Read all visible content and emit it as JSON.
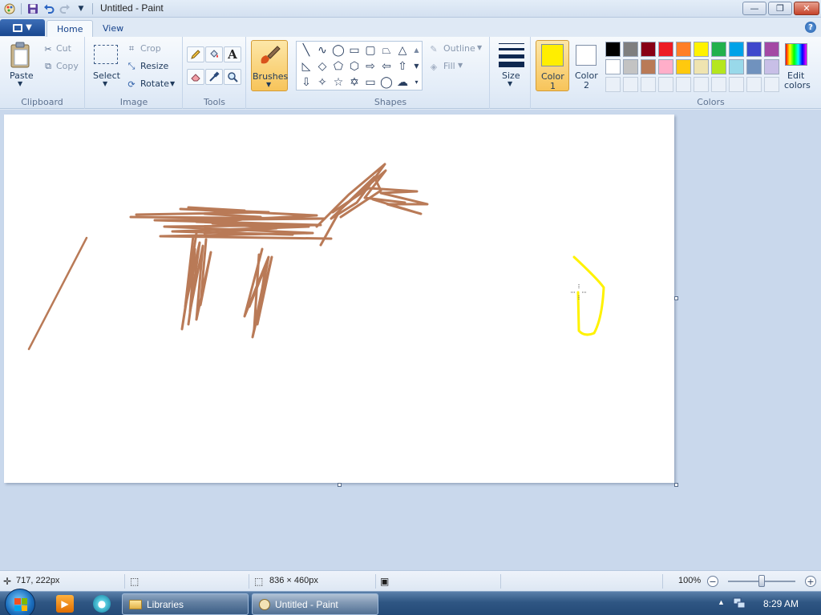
{
  "window": {
    "title": "Untitled - Paint",
    "minimize_label": "—",
    "restore_label": "❐",
    "close_label": "✕"
  },
  "tabs": [
    {
      "label": "Home"
    },
    {
      "label": "View"
    }
  ],
  "clipboard": {
    "paste_label": "Paste",
    "cut_label": "Cut",
    "copy_label": "Copy",
    "group_label": "Clipboard"
  },
  "image": {
    "select_label": "Select",
    "crop_label": "Crop",
    "resize_label": "Resize",
    "rotate_label": "Rotate",
    "group_label": "Image"
  },
  "tools": {
    "group_label": "Tools"
  },
  "brushes": {
    "label": "Brushes"
  },
  "shapes": {
    "outline_label": "Outline",
    "fill_label": "Fill",
    "group_label": "Shapes"
  },
  "size": {
    "label": "Size"
  },
  "colors": {
    "color1_label_line1": "Color",
    "color1_label_line2": "1",
    "color2_label_line1": "Color",
    "color2_label_line2": "2",
    "edit_line1": "Edit",
    "edit_line2": "colors",
    "group_label": "Colors",
    "color1_value": "#ffee00",
    "color2_value": "#ffffff",
    "palette_row1": [
      "#000000",
      "#7f7f7f",
      "#880015",
      "#ed1c24",
      "#ff7f27",
      "#fff200",
      "#22b14c",
      "#00a2e8",
      "#3f48cc",
      "#a349a4"
    ],
    "palette_row2": [
      "#ffffff",
      "#c3c3c3",
      "#b97a57",
      "#ffaec9",
      "#ffc90e",
      "#efe4b0",
      "#b5e61d",
      "#99d9ea",
      "#7092be",
      "#c8bfe7"
    ]
  },
  "status": {
    "cursor_position": "717, 222px",
    "canvas_size": "836 × 460px",
    "zoom": "100%",
    "zoom_level": 1.0
  },
  "taskbar": {
    "items": [
      {
        "label": "Libraries"
      },
      {
        "label": "Untitled - Paint"
      }
    ],
    "clock": "8:29 AM"
  }
}
